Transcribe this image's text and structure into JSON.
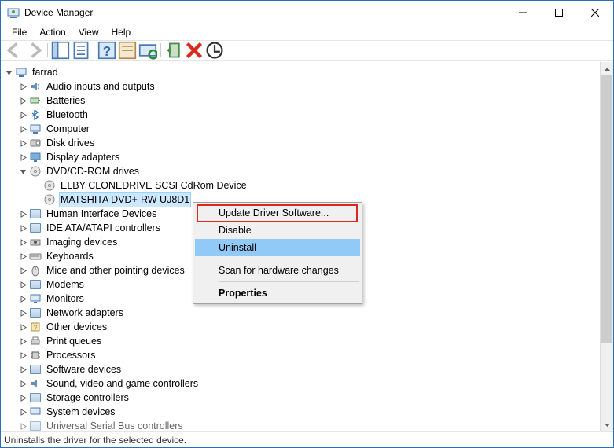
{
  "window": {
    "title": "Device Manager"
  },
  "menu": {
    "file": "File",
    "action": "Action",
    "view": "View",
    "help": "Help"
  },
  "tree": {
    "root": "farrad",
    "items": [
      "Audio inputs and outputs",
      "Batteries",
      "Bluetooth",
      "Computer",
      "Disk drives",
      "Display adapters"
    ],
    "dvd_label": "DVD/CD-ROM drives",
    "dvd_children": [
      "ELBY CLONEDRIVE SCSI CdRom Device",
      "MATSHITA DVD+-RW UJ8D1"
    ],
    "rest": [
      "Human Interface Devices",
      "IDE ATA/ATAPI controllers",
      "Imaging devices",
      "Keyboards",
      "Mice and other pointing devices",
      "Modems",
      "Monitors",
      "Network adapters",
      "Other devices",
      "Print queues",
      "Processors",
      "Software devices",
      "Sound, video and game controllers",
      "Storage controllers",
      "System devices",
      "Universal Serial Bus controllers"
    ]
  },
  "contextmenu": {
    "update": "Update Driver Software...",
    "disable": "Disable",
    "uninstall": "Uninstall",
    "scan": "Scan for hardware changes",
    "properties": "Properties"
  },
  "statusbar": {
    "text": "Uninstalls the driver for the selected device."
  }
}
